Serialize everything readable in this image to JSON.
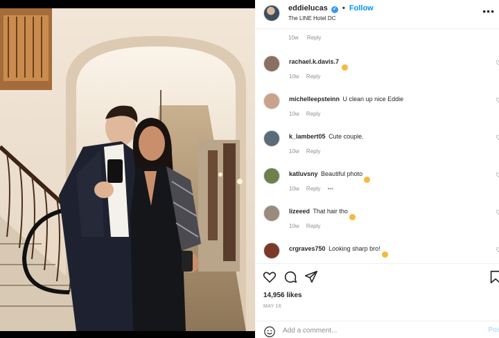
{
  "post": {
    "username": "eddielucas",
    "follow_label": "Follow",
    "location": "The LINE Hotel DC"
  },
  "top_meta": {
    "time": "10w",
    "reply": "Reply"
  },
  "comments": [
    {
      "user": "rachael.k.davis.7",
      "text": "",
      "time": "10w",
      "reply": "Reply",
      "avatar_color": "#8a7060"
    },
    {
      "user": "michelleepsteinn",
      "text": "U clean up nice Eddie",
      "time": "10w",
      "reply": "Reply",
      "avatar_color": "#c9a28a"
    },
    {
      "user": "k_lambert05",
      "text": "Cute couple.",
      "time": "10w",
      "reply": "Reply",
      "avatar_color": "#5a6b7a"
    },
    {
      "user": "katluvsny",
      "text": "Beautiful photo",
      "time": "10w",
      "reply": "Reply",
      "more": "•••",
      "avatar_color": "#6f7f4e"
    },
    {
      "user": "lizeeed",
      "text": "That hair tho",
      "time": "10w",
      "reply": "Reply",
      "avatar_color": "#9b8b7c"
    },
    {
      "user": "crgraves750",
      "text": "Looking sharp bro!",
      "time": "",
      "reply": "",
      "avatar_color": "#7a3a2a"
    }
  ],
  "likes_text": "14,956 likes",
  "date_text": "MAY 16",
  "add_comment_placeholder": "Add a comment...",
  "post_button": "Post",
  "icons": {
    "like": "heart-icon",
    "comment": "comment-icon",
    "share": "share-icon",
    "save": "bookmark-icon",
    "more": "more-icon",
    "emoji": "smile-icon"
  },
  "colors": {
    "follow": "#0095f6",
    "verified": "#3897f0",
    "muted": "#8e8e8e"
  }
}
